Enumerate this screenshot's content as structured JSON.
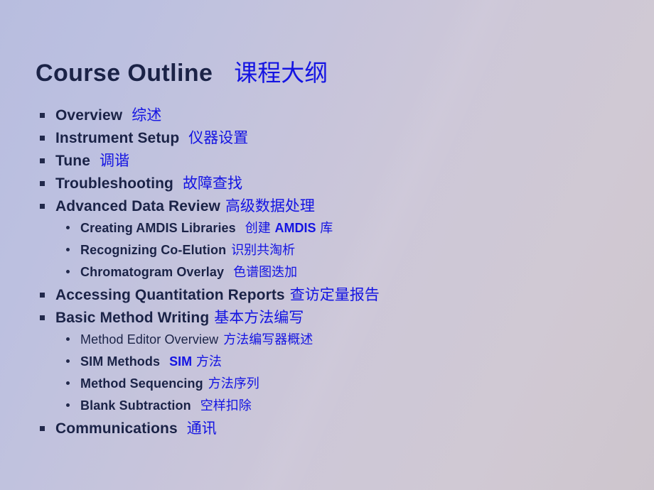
{
  "slide": {
    "title_en": "Course Outline",
    "title_zh": "课程大纲",
    "background_colors": {
      "top_left": "#b9bedf",
      "top_right": "#cdc7d6",
      "bottom_left": "#c0c3de",
      "bottom_right": "#cfc7ce"
    },
    "text_colors": {
      "english": "#1b2347",
      "chinese": "#1414e2"
    },
    "bullet_markers": {
      "level1": "square-bullet",
      "level2": "round-bullet"
    }
  },
  "outline": [
    {
      "level": 1,
      "en": "Overview",
      "gap": "md",
      "zh": "综述"
    },
    {
      "level": 1,
      "en": "Instrument Setup",
      "gap": "md",
      "zh": "仪器设置"
    },
    {
      "level": 1,
      "en": "Tune",
      "gap": "md",
      "zh": "调谐"
    },
    {
      "level": 1,
      "en": "Troubleshooting",
      "gap": "md",
      "zh": "故障查找"
    },
    {
      "level": 1,
      "en": "Advanced Data Review",
      "gap": "sm",
      "zh": "高级数据处理"
    },
    {
      "level": 2,
      "en": "Creating AMDIS Libraries",
      "gap": "md",
      "zh_pre": "创建 ",
      "zh_hl": "AMDIS",
      "zh_post": " 库"
    },
    {
      "level": 2,
      "en": "Recognizing Co-Elution",
      "gap": "sm",
      "zh": "识别共淘析"
    },
    {
      "level": 2,
      "en": "Chromatogram Overlay",
      "gap": "md",
      "zh": "色谱图迭加"
    },
    {
      "level": 1,
      "en": "Accessing Quantitation Reports",
      "gap": "sm",
      "zh": "查访定量报告"
    },
    {
      "level": 1,
      "en": "Basic Method Writing",
      "gap": "sm",
      "zh": "基本方法编写"
    },
    {
      "level": 2,
      "en": "Method Editor Overview",
      "weight": "light",
      "gap": "sm",
      "zh": "方法编写器概述"
    },
    {
      "level": 2,
      "en": "SIM Methods",
      "gap": "md",
      "zh_hl": "SIM",
      "zh_post": " 方法"
    },
    {
      "level": 2,
      "en": "Method Sequencing",
      "gap": "sm",
      "zh": "方法序列"
    },
    {
      "level": 2,
      "en": "Blank Subtraction",
      "gap": "md",
      "zh": "空样扣除"
    },
    {
      "level": 1,
      "en": "Communications",
      "gap": "md",
      "zh": "通讯"
    }
  ]
}
